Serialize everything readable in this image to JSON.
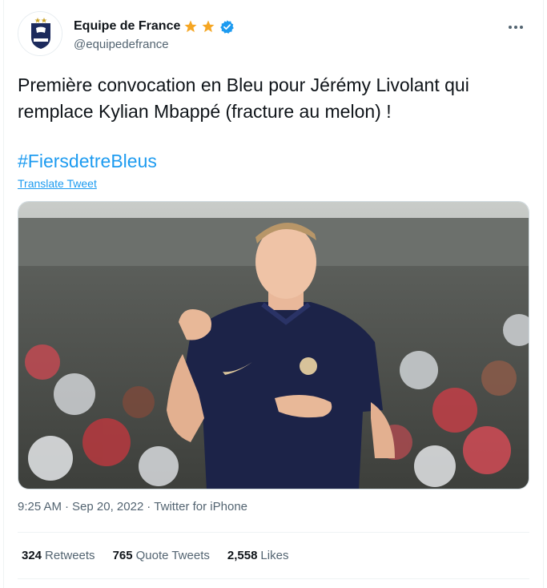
{
  "author": {
    "display_name": "Equipe de France",
    "handle": "@equipedefrance",
    "avatar_text": "FRANCE",
    "star_color": "#f5a623",
    "verified_color": "#1d9bf0"
  },
  "tweet": {
    "text": "Première convocation en Bleu pour Jérémy Livolant qui remplace Kylian Mbappé (fracture au melon) !",
    "hashtag": "#FiersdetreBleus",
    "translate_label": "Translate Tweet"
  },
  "meta": {
    "time": "9:25 AM",
    "separator": "·",
    "date": "Sep 20, 2022",
    "separator2": "·",
    "app": "Twitter for iPhone"
  },
  "stats": {
    "retweets_count": "324",
    "retweets_label": "Retweets",
    "quotes_count": "765",
    "quotes_label": "Quote Tweets",
    "likes_count": "2,558",
    "likes_label": "Likes"
  },
  "colors": {
    "link": "#1d9bf0",
    "text": "#0f1419",
    "muted": "#536471",
    "jersey": "#1c2348"
  },
  "icons": [
    "star-icon",
    "verified-badge-icon",
    "more-options-icon",
    "fff-crest-icon"
  ]
}
